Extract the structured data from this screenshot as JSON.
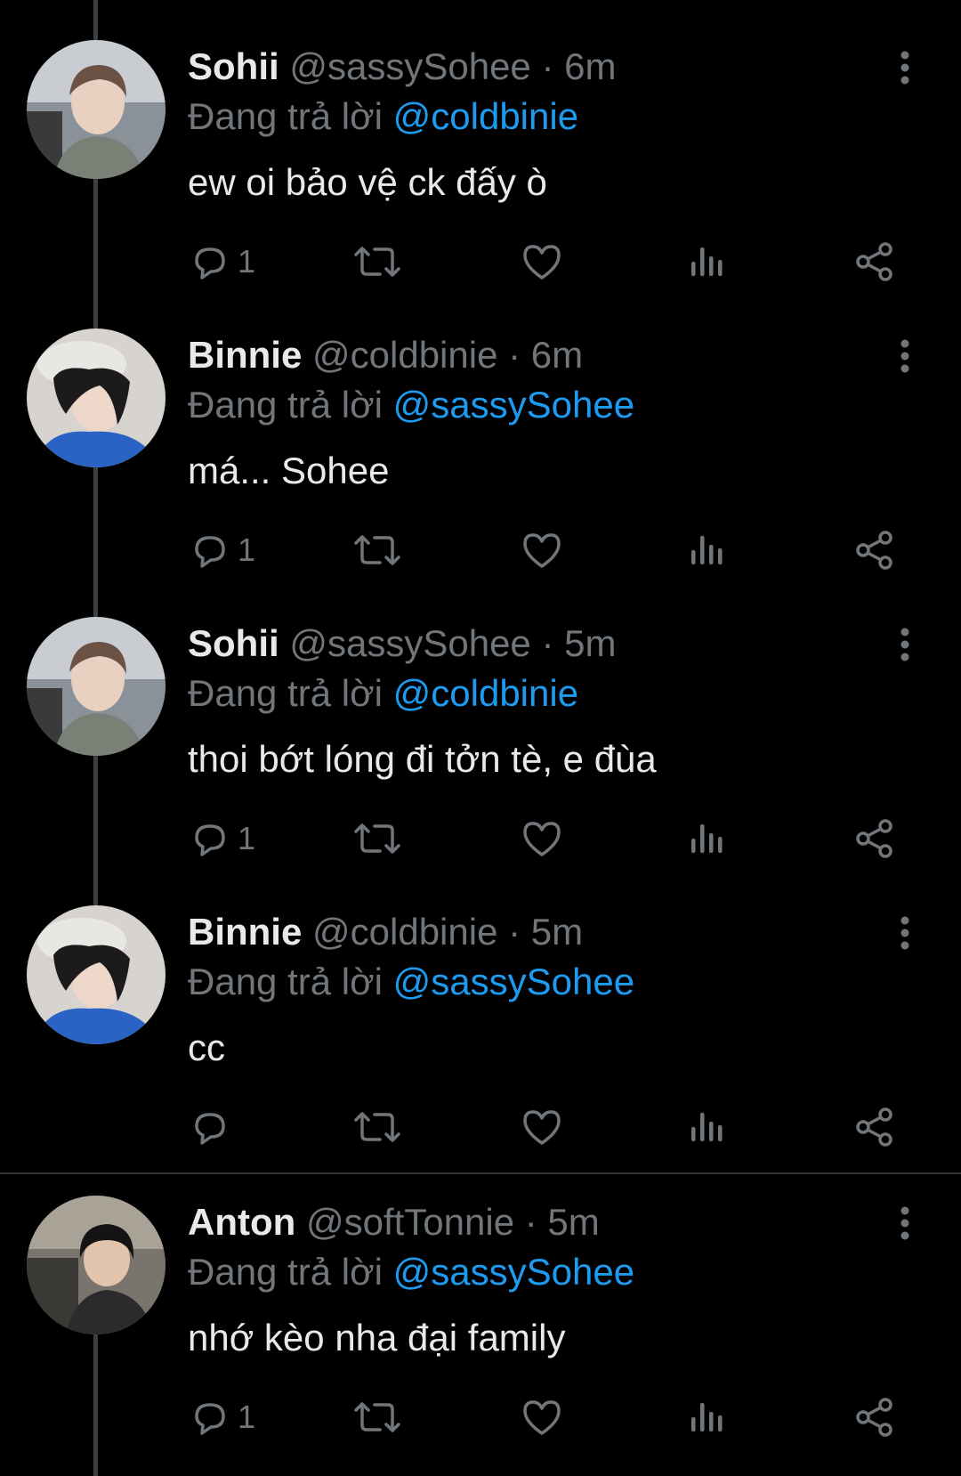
{
  "replying_prefix": "Đang trả lời",
  "tweets": [
    {
      "name": "Sohii",
      "handle": "@sassySohee",
      "time": "· 6m",
      "reply_to": "@coldbinie",
      "text": "ew oi bảo vệ ck đấy ò",
      "reply_count": "1",
      "avatar": "sohii-avatar"
    },
    {
      "name": "Binnie",
      "handle": "@coldbinie",
      "time": "· 6m",
      "reply_to": "@sassySohee",
      "text": "má... Sohee",
      "reply_count": "1",
      "avatar": "binnie-avatar"
    },
    {
      "name": "Sohii",
      "handle": "@sassySohee",
      "time": "· 5m",
      "reply_to": "@coldbinie",
      "text": "thoi bớt lóng đi tởn tè, e đùa",
      "reply_count": "1",
      "avatar": "sohii-avatar"
    },
    {
      "name": "Binnie",
      "handle": "@coldbinie",
      "time": "· 5m",
      "reply_to": "@sassySohee",
      "text": "cc",
      "reply_count": "",
      "avatar": "binnie-avatar"
    },
    {
      "name": "Anton",
      "handle": "@softTonnie",
      "time": "· 5m",
      "reply_to": "@sassySohee",
      "text": "nhớ kèo nha đại family",
      "reply_count": "1",
      "avatar": "anton-avatar"
    }
  ],
  "icons": {
    "reply": "reply-icon",
    "retweet": "retweet-icon",
    "like": "heart-icon",
    "views": "views-icon",
    "share": "share-icon",
    "more": "more-vertical-icon"
  },
  "colors": {
    "background": "#000000",
    "text": "#e7e9ea",
    "secondary": "#71767b",
    "accent": "#1d9bf0",
    "thread_line": "#3a3f45"
  }
}
